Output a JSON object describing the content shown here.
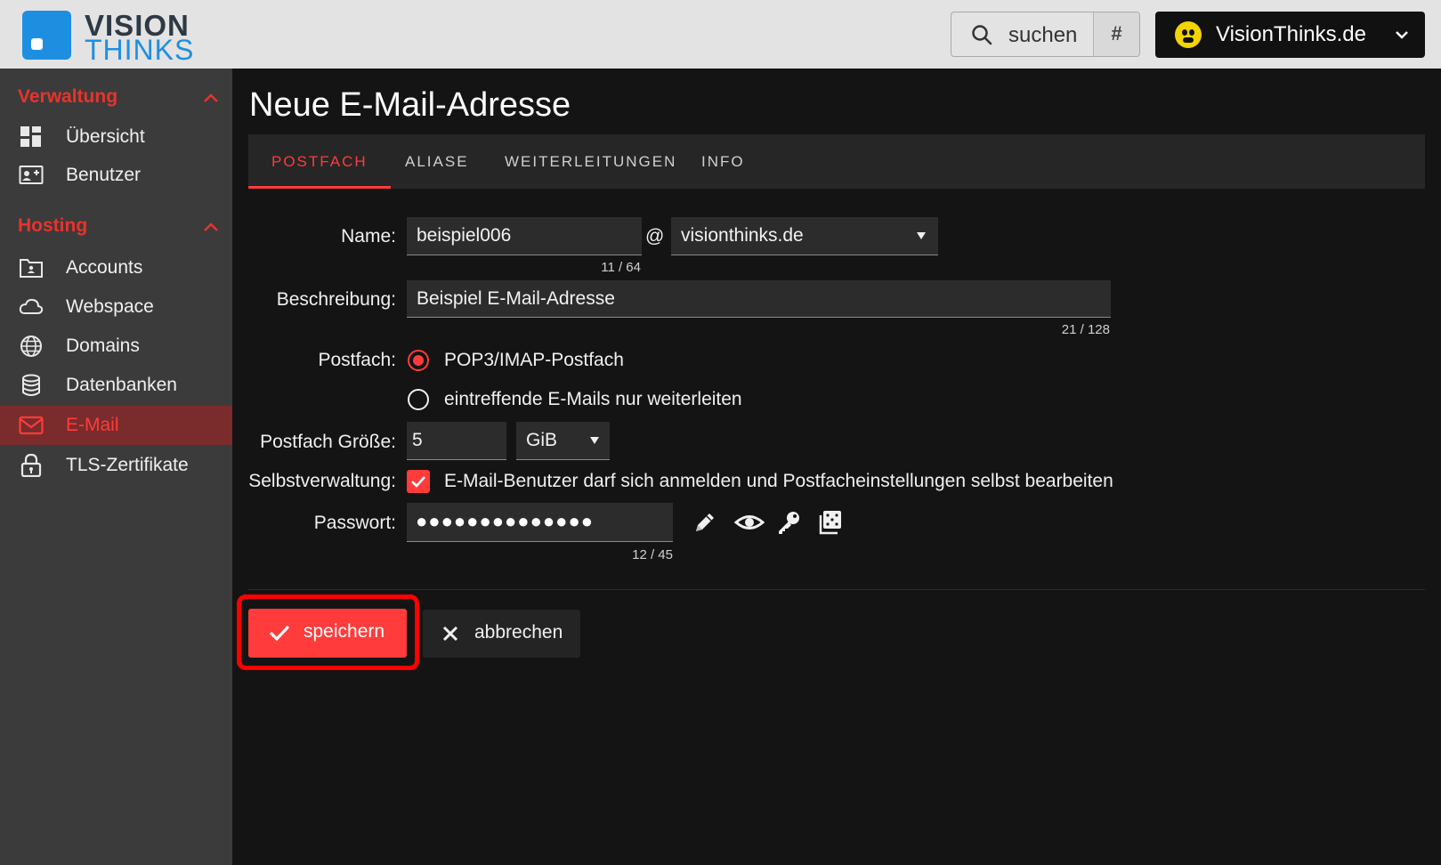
{
  "header": {
    "logo_line1": "VISION",
    "logo_line2": "THINKS",
    "search_label": "suchen",
    "search_key": "#",
    "account_name": "VisionThinks.de"
  },
  "sidebar": {
    "sections": [
      {
        "title": "Verwaltung",
        "items": [
          {
            "label": "Übersicht",
            "icon": "dashboard-icon"
          },
          {
            "label": "Benutzer",
            "icon": "user-card-icon"
          }
        ]
      },
      {
        "title": "Hosting",
        "items": [
          {
            "label": "Accounts",
            "icon": "folder-user-icon"
          },
          {
            "label": "Webspace",
            "icon": "cloud-icon"
          },
          {
            "label": "Domains",
            "icon": "globe-icon"
          },
          {
            "label": "Datenbanken",
            "icon": "database-icon"
          },
          {
            "label": "E-Mail",
            "icon": "mail-icon",
            "active": true
          },
          {
            "label": "TLS-Zertifikate",
            "icon": "lock-icon"
          }
        ]
      }
    ]
  },
  "main": {
    "title": "Neue E-Mail-Adresse",
    "tabs": [
      {
        "label": "POSTFACH",
        "active": true
      },
      {
        "label": "ALIASE"
      },
      {
        "label": "WEITERLEITUNGEN"
      },
      {
        "label": "INFO"
      }
    ]
  },
  "form": {
    "name_label": "Name:",
    "name_value": "beispiel006",
    "name_counter": "11 / 64",
    "at_sign": "@",
    "domain_value": "visionthinks.de",
    "desc_label": "Beschreibung:",
    "desc_value": "Beispiel E-Mail-Adresse",
    "desc_counter": "21 / 128",
    "mailbox_label": "Postfach:",
    "mailbox_option1": "POP3/IMAP-Postfach",
    "mailbox_option2": "eintreffende E-Mails nur weiterleiten",
    "size_label": "Postfach Größe:",
    "size_value": "5",
    "size_unit": "GiB",
    "self_label": "Selbstverwaltung:",
    "self_text": "E-Mail-Benutzer darf sich anmelden und Postfacheinstellungen selbst bearbeiten",
    "password_label": "Passwort:",
    "password_mask": "●●●●●●●●●●●●●●",
    "password_counter": "12 / 45"
  },
  "actions": {
    "save_label": "speichern",
    "cancel_label": "abbrechen"
  },
  "colors": {
    "accent": "#ff3b3b",
    "brand_blue": "#1e8fe0",
    "sidebar_bg": "#3b3b3b",
    "main_bg": "#141414"
  }
}
